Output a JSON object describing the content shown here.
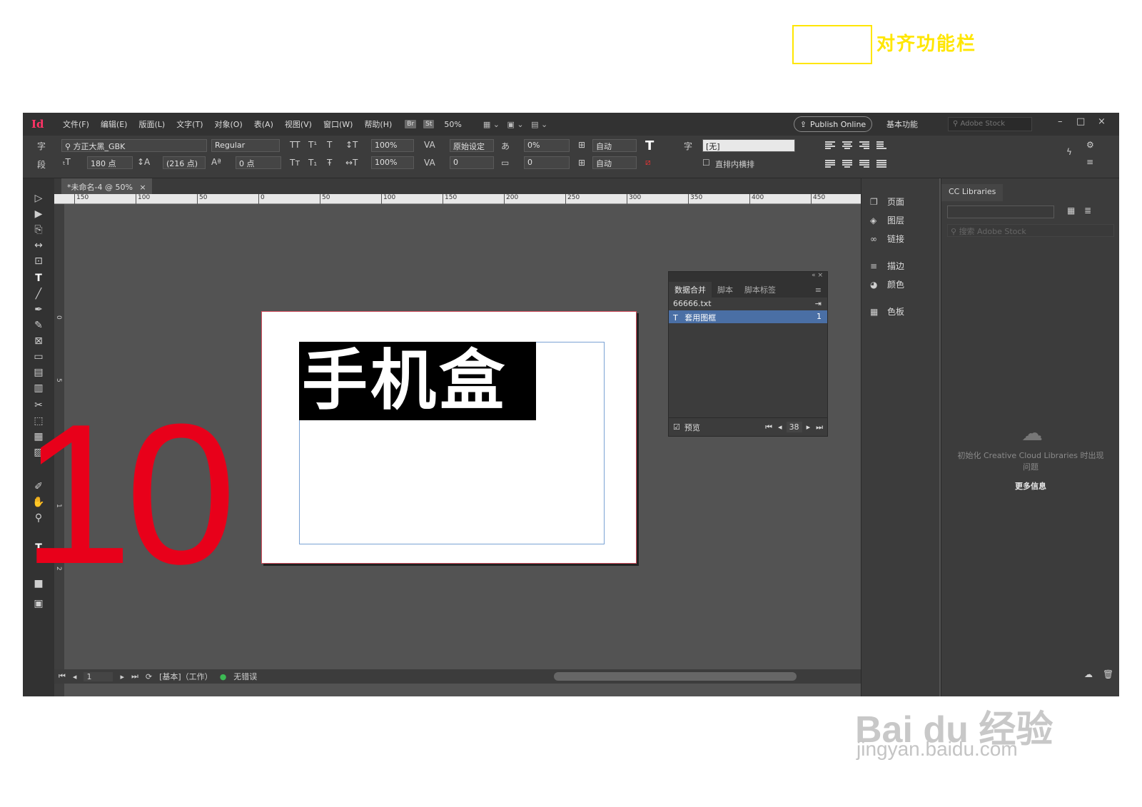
{
  "app": {
    "logo": "Id",
    "menu": [
      "文件(F)",
      "编辑(E)",
      "版面(L)",
      "文字(T)",
      "对象(O)",
      "表(A)",
      "视图(V)",
      "窗口(W)",
      "帮助(H)"
    ],
    "bridge_badge": "Br",
    "stock_badge": "St",
    "zoom": "50%",
    "publish_label": "Publish Online",
    "workspace": "基本功能",
    "stock_search_placeholder": "Adobe Stock",
    "win_min": "–",
    "win_max": "□",
    "win_close": "×"
  },
  "control": {
    "char_tab": "字",
    "para_tab": "段",
    "font_family": "方正大黑_GBK",
    "font_style": "Regular",
    "font_size": "180 点",
    "leading": "(216 点)",
    "baseline_shift": "0 点",
    "vscale": "100%",
    "hscale": "100%",
    "kerning": "原始设定",
    "tracking": "0",
    "tsume": "0%",
    "tsume2": "0",
    "grid_auto1": "自动",
    "grid_auto2": "自动",
    "char_style_label": "字",
    "char_style": "[无]",
    "vertical_in_horizontal": "直排内横排",
    "tt_caps": "TT",
    "tt_super": "T¹",
    "tt_under": "T",
    "tt_small": "Tт",
    "tt_sub": "T₁",
    "tt_strike": "Ŧ"
  },
  "annotation": {
    "highlight_label": "对齐功能栏",
    "big_number": "10"
  },
  "document": {
    "tab_title": "*未命名-4 @ 50%",
    "tab_close": "×",
    "text_frame_content": "手机盒"
  },
  "ruler": {
    "h_ticks": [
      "150",
      "100",
      "50",
      "0",
      "50",
      "100",
      "150",
      "200",
      "250",
      "300",
      "350",
      "400",
      "450"
    ],
    "v_ticks": [
      "0",
      "5",
      "1",
      "1",
      "2"
    ]
  },
  "data_merge_panel": {
    "tabs": [
      "数据合并",
      "脚本",
      "脚本标签"
    ],
    "source_file": "66666.txt",
    "field_name": "套用图框",
    "field_type": "T",
    "field_count": "1",
    "preview_label": "预览",
    "record_number": "38"
  },
  "dock": {
    "items": [
      "页面",
      "图层",
      "链接",
      "描边",
      "颜色",
      "色板"
    ]
  },
  "cc_libraries": {
    "tab": "CC Libraries",
    "search_placeholder": "搜索 Adobe Stock",
    "message": "初始化 Creative Cloud Libraries 时出现问题",
    "more_info": "更多信息"
  },
  "status_bar": {
    "page_number": "1",
    "profile": "[基本]（工作）",
    "preflight": "无错误"
  },
  "watermark": {
    "brand": "Bai du 经验",
    "url": "jingyan.baidu.com"
  }
}
